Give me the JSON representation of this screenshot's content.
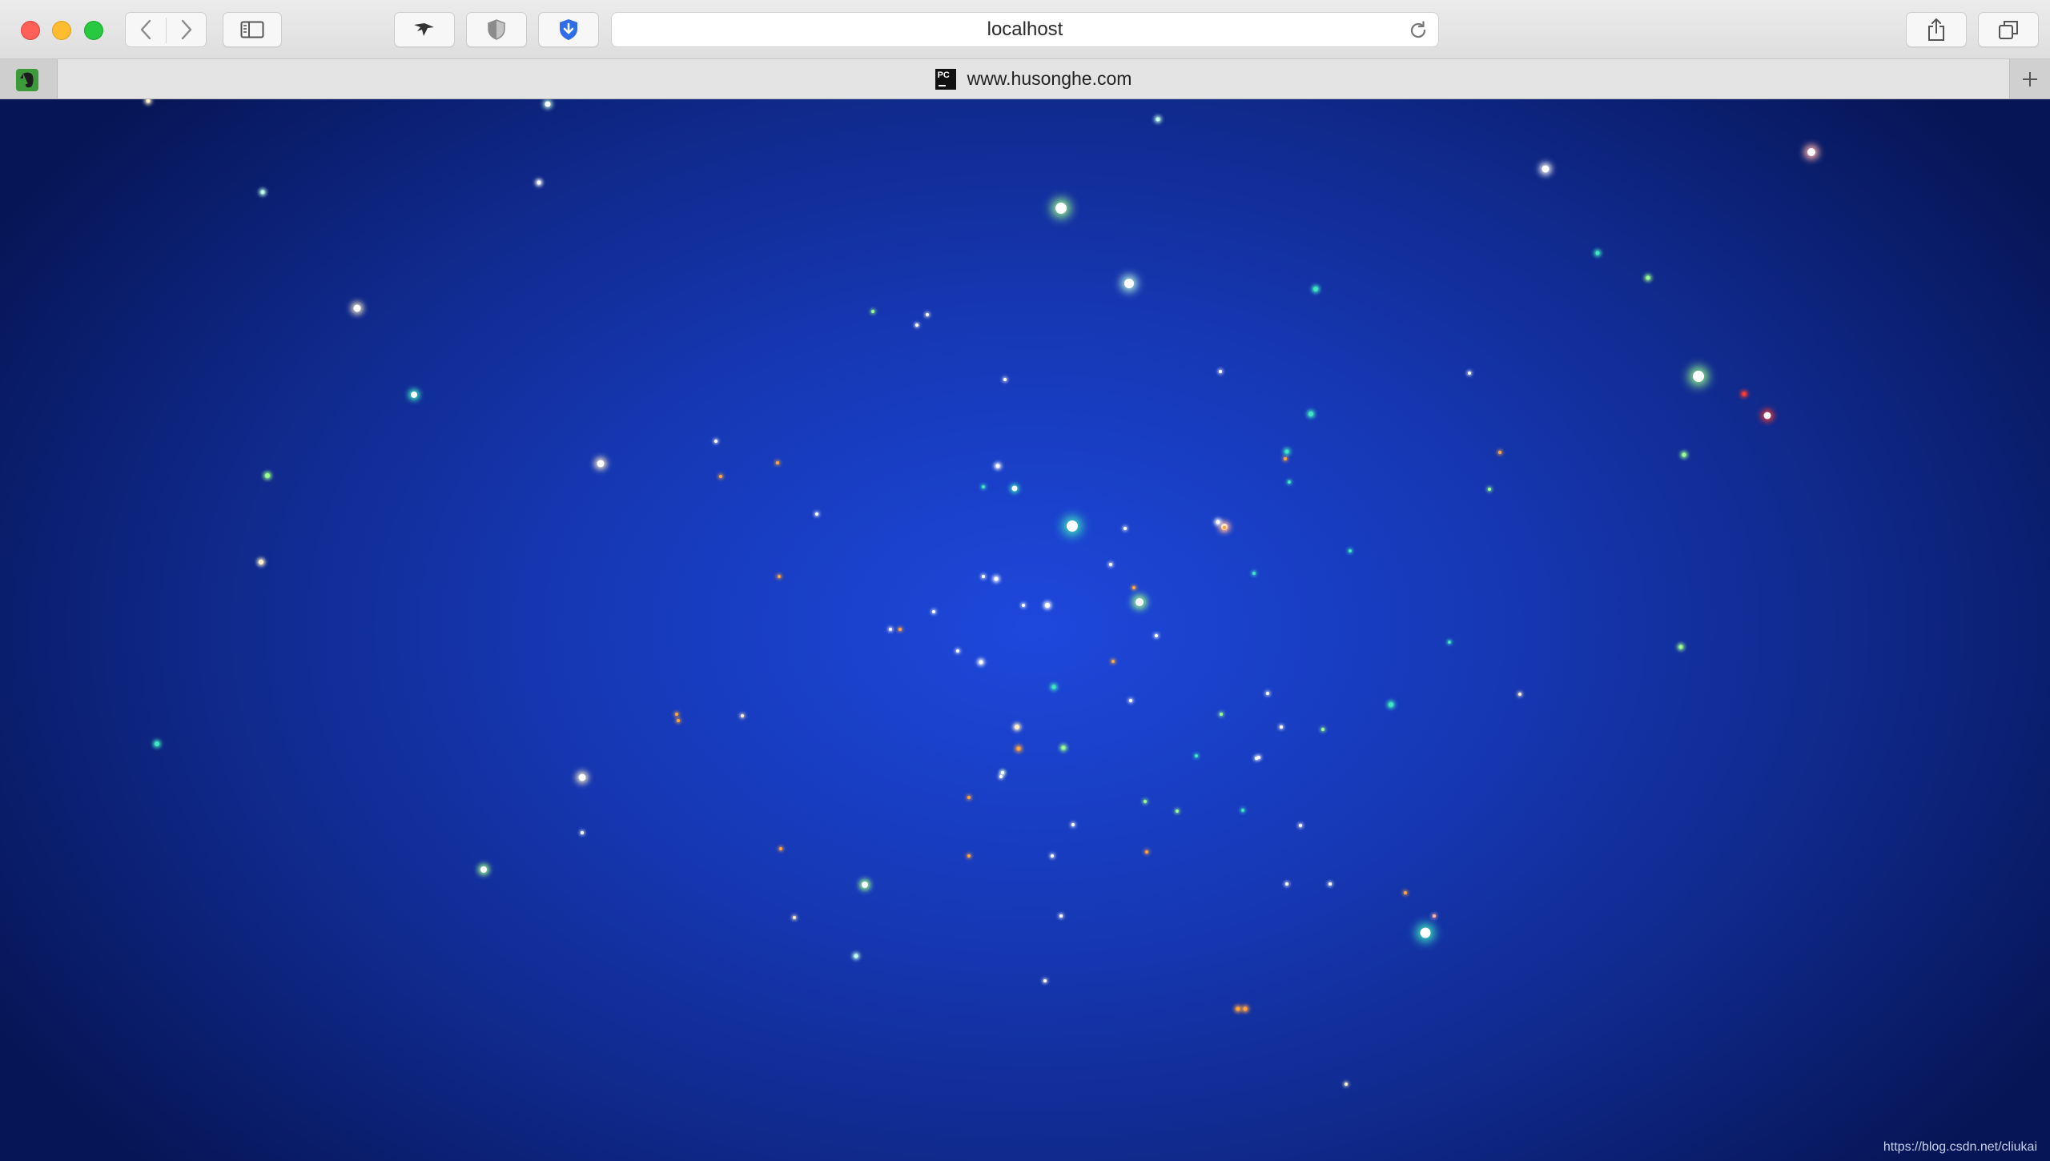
{
  "browser": {
    "address": "localhost",
    "tab_title": "www.husonghe.com",
    "pinned_tab_icon": "evernote-icon",
    "tab_favicon": "pycharm-icon",
    "toolbar_icons": [
      "back-icon",
      "forward-icon",
      "sidebar-icon",
      "bird-icon",
      "shield-icon",
      "download-shield-icon",
      "reload-icon",
      "share-icon",
      "tabs-overview-icon",
      "plus-icon"
    ]
  },
  "page": {
    "background_center_color": "#1d48dc",
    "background_edge_color": "#061555",
    "star_colors": [
      "#ffffff",
      "#bfffe6",
      "#fff0c8",
      "#ffb3a8",
      "#ff3b2f",
      "#3ee8c0",
      "#9bff8a",
      "#ffa53c"
    ],
    "watermark": "https://blog.csdn.net/cliukai"
  }
}
